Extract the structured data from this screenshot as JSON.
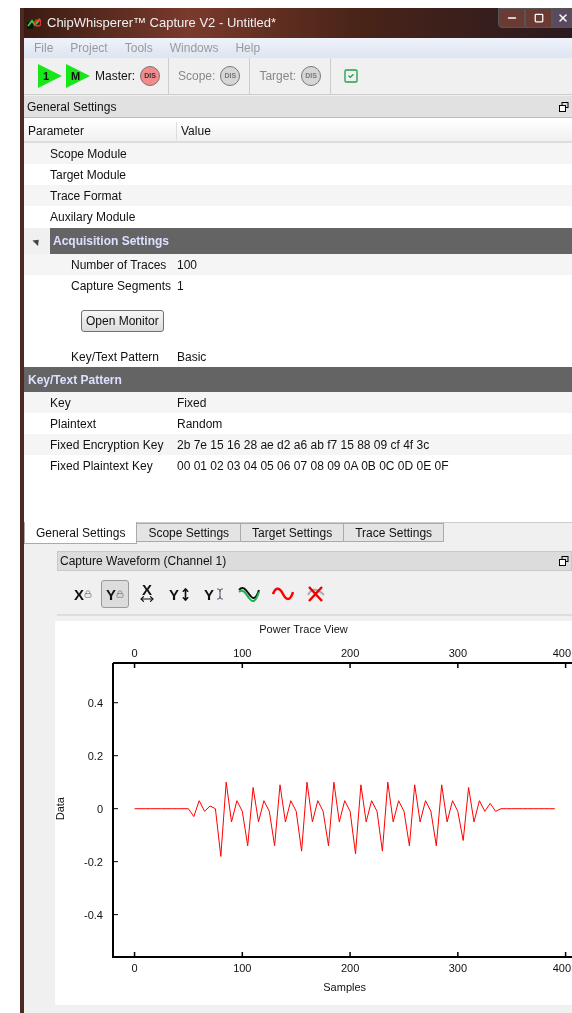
{
  "window": {
    "title": "ChipWhisperer™ Capture V2 - Untitled*"
  },
  "menu": [
    "File",
    "Project",
    "Tools",
    "Windows",
    "Help"
  ],
  "toolbar": {
    "run_buttons": [
      "1",
      "M"
    ],
    "connections": [
      {
        "label": "Master:",
        "status": "DIS",
        "active": true
      },
      {
        "label": "Scope:",
        "status": "DIS",
        "active": false
      },
      {
        "label": "Target:",
        "status": "DIS",
        "active": false
      }
    ],
    "checkbox": {
      "checked": true
    }
  },
  "general_settings": {
    "title": "General Settings",
    "columns": [
      "Parameter",
      "Value"
    ],
    "sections": [
      {
        "items": [
          {
            "kind": "param",
            "name": "Scope Module"
          },
          {
            "kind": "param",
            "name": "Target Module"
          },
          {
            "kind": "param",
            "name": "Trace Format"
          },
          {
            "kind": "param",
            "name": "Auxilary Module"
          },
          {
            "kind": "group",
            "name": "Acquisition Settings",
            "expanded": true,
            "children": [
              {
                "kind": "param",
                "name": "Number of Traces",
                "value": "100"
              },
              {
                "kind": "param",
                "name": "Capture Segments",
                "value": "1"
              },
              {
                "kind": "button",
                "name": "Open Monitor"
              },
              {
                "kind": "param",
                "name": "Key/Text Pattern",
                "value": "Basic"
              }
            ]
          }
        ]
      },
      {
        "title": "Key/Text Pattern",
        "items": [
          {
            "kind": "param",
            "name": "Key",
            "value": "Fixed"
          },
          {
            "kind": "param",
            "name": "Plaintext",
            "value": "Random"
          },
          {
            "kind": "param",
            "name": "Fixed Encryption Key",
            "value": "2b 7e 15 16 28 ae d2 a6 ab f7 15 88 09 cf 4f 3c"
          },
          {
            "kind": "param",
            "name": "Fixed Plaintext Key",
            "value": "00 01 02 03 04 05 06 07 08 09 0A 0B 0C 0D 0E 0F"
          }
        ]
      }
    ]
  },
  "tabs": [
    {
      "label": "General Settings",
      "selected": true
    },
    {
      "label": "Scope Settings",
      "selected": false
    },
    {
      "label": "Target Settings",
      "selected": false
    },
    {
      "label": "Trace Settings",
      "selected": false
    }
  ],
  "waveform": {
    "title": "Capture Waveform (Channel 1)",
    "tools": [
      {
        "kind": "xlock",
        "label": "X",
        "selected": false
      },
      {
        "kind": "ylock",
        "label": "Y",
        "selected": true
      },
      {
        "kind": "xfit",
        "label": "X",
        "selected": false
      },
      {
        "kind": "yfit",
        "label": "Y",
        "selected": false
      },
      {
        "kind": "ycursor",
        "label": "Y",
        "selected": false
      },
      {
        "kind": "wave2",
        "selected": false
      },
      {
        "kind": "wave",
        "selected": false
      },
      {
        "kind": "clear",
        "selected": false
      }
    ],
    "top_axis_ticks": [
      "0",
      "100",
      "200",
      "300",
      "400"
    ],
    "bottom_axis_ticks": [
      "0",
      "100",
      "200",
      "300",
      "400"
    ],
    "chart_data": {
      "type": "line",
      "title": "Power Trace View",
      "xlabel": "Samples",
      "ylabel": "Data",
      "xlim": [
        -20,
        405
      ],
      "ylim": [
        -0.56,
        0.55
      ],
      "xticks": [
        0,
        100,
        200,
        300,
        400
      ],
      "yticks": [
        -0.4,
        -0.2,
        0,
        0.2,
        0.4
      ],
      "x": [
        0,
        5,
        10,
        15,
        20,
        25,
        30,
        35,
        40,
        45,
        50,
        55,
        60,
        65,
        70,
        75,
        80,
        85,
        90,
        95,
        100,
        105,
        110,
        115,
        120,
        125,
        130,
        135,
        140,
        145,
        150,
        155,
        160,
        165,
        170,
        175,
        180,
        185,
        190,
        195,
        200,
        205,
        210,
        215,
        220,
        225,
        230,
        235,
        240,
        245,
        250,
        255,
        260,
        265,
        270,
        275,
        280,
        285,
        290,
        295,
        300,
        305,
        310,
        315,
        320,
        325,
        330,
        335,
        340,
        345,
        350,
        355,
        360,
        365,
        370,
        375,
        380,
        385,
        390
      ],
      "series": [
        {
          "color": "#ff0000",
          "values": [
            0,
            0,
            0,
            0,
            0,
            0,
            0,
            0,
            0,
            0,
            0,
            -0.03,
            0.03,
            -0.01,
            0.01,
            0,
            -0.18,
            0.1,
            -0.05,
            0.03,
            -0.01,
            -0.14,
            0.08,
            -0.05,
            0.03,
            -0.01,
            -0.14,
            0.09,
            -0.05,
            0.03,
            -0.01,
            -0.16,
            0.1,
            -0.05,
            0.03,
            -0.01,
            -0.14,
            0.1,
            -0.05,
            0.03,
            -0.01,
            -0.17,
            0.09,
            -0.05,
            0.03,
            -0.01,
            -0.16,
            0.1,
            -0.05,
            0.03,
            -0.01,
            -0.14,
            0.09,
            -0.05,
            0.03,
            -0.01,
            -0.14,
            0.09,
            -0.05,
            0.03,
            -0.01,
            -0.12,
            0.08,
            -0.05,
            0.03,
            -0.01,
            0.02,
            -0.01,
            0,
            0,
            0,
            0,
            0,
            0,
            0,
            0,
            0,
            0,
            0
          ]
        }
      ]
    }
  }
}
